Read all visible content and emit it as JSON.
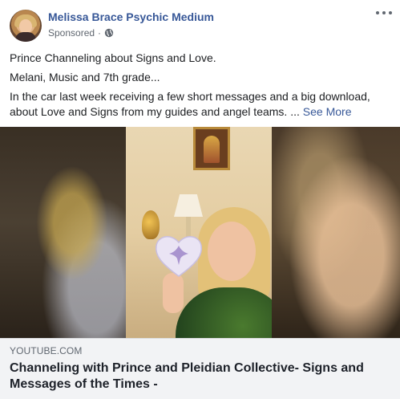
{
  "header": {
    "page_name": "Melissa Brace Psychic Medium",
    "sponsored_label": "Sponsored",
    "separator": "·",
    "privacy_icon": "globe-icon",
    "more_icon": "more-options-icon"
  },
  "post": {
    "line1": "Prince Channeling about Signs and Love.",
    "line2": "Melani, Music and 7th grade...",
    "line3": "In the car last week receiving a few short messages and a big download, about Love and Signs from my guides and angel teams. ...",
    "see_more": "See More"
  },
  "link": {
    "domain": "YOUTUBE.COM",
    "title": "Channeling with Prince and Pleidian Collective- Signs and Messages of the Times -"
  },
  "colors": {
    "link_blue": "#385898",
    "meta_gray": "#606770",
    "card_bg": "#f2f3f5"
  }
}
